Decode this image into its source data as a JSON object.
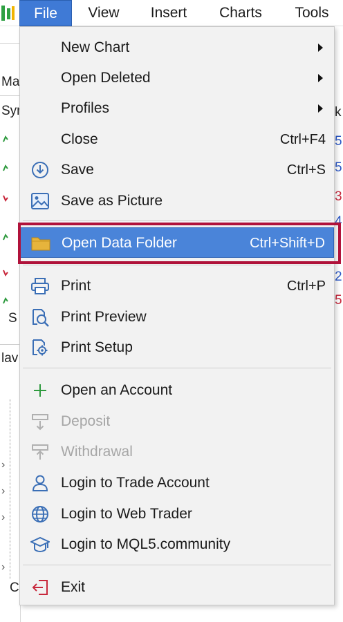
{
  "menubar": {
    "items": [
      {
        "label": "File"
      },
      {
        "label": "View"
      },
      {
        "label": "Insert"
      },
      {
        "label": "Charts"
      },
      {
        "label": "Tools"
      }
    ]
  },
  "background": {
    "left_fragments": [
      "Ma",
      "Syr",
      "S",
      "lav",
      "C"
    ],
    "right_fragments": [
      "k",
      "5",
      "5",
      "3",
      "4",
      "2",
      "5"
    ]
  },
  "file_menu": {
    "items": [
      {
        "label": "New Chart",
        "shortcut": "",
        "submenu": true,
        "icon": "none"
      },
      {
        "label": "Open Deleted",
        "shortcut": "",
        "submenu": true,
        "icon": "none"
      },
      {
        "label": "Profiles",
        "shortcut": "",
        "submenu": true,
        "icon": "none"
      },
      {
        "label": "Close",
        "shortcut": "Ctrl+F4",
        "icon": "none"
      },
      {
        "label": "Save",
        "shortcut": "Ctrl+S",
        "icon": "save-icon"
      },
      {
        "label": "Save as Picture",
        "shortcut": "",
        "icon": "picture-icon"
      },
      {
        "label": "Open Data Folder",
        "shortcut": "Ctrl+Shift+D",
        "icon": "folder-icon",
        "highlighted": true
      },
      {
        "label": "Print",
        "shortcut": "Ctrl+P",
        "icon": "printer-icon"
      },
      {
        "label": "Print Preview",
        "shortcut": "",
        "icon": "print-preview-icon"
      },
      {
        "label": "Print Setup",
        "shortcut": "",
        "icon": "print-setup-icon"
      },
      {
        "label": "Open an Account",
        "shortcut": "",
        "icon": "plus-icon"
      },
      {
        "label": "Deposit",
        "shortcut": "",
        "icon": "deposit-icon",
        "disabled": true
      },
      {
        "label": "Withdrawal",
        "shortcut": "",
        "icon": "withdrawal-icon",
        "disabled": true
      },
      {
        "label": "Login to Trade Account",
        "shortcut": "",
        "icon": "user-icon"
      },
      {
        "label": "Login to Web Trader",
        "shortcut": "",
        "icon": "globe-icon"
      },
      {
        "label": "Login to MQL5.community",
        "shortcut": "",
        "icon": "graduation-cap-icon"
      },
      {
        "label": "Exit",
        "shortcut": "",
        "icon": "exit-icon"
      }
    ]
  },
  "colors": {
    "highlight": "#4a84d9",
    "menubar_active": "#3f7ad6",
    "callout_border": "#b0123a",
    "menu_background": "#f2f2f2",
    "icon_blue": "#3b6fb6",
    "plus_green": "#2e9a3e",
    "exit_red": "#c8283c",
    "folder_yellow": "#e6b43c"
  }
}
